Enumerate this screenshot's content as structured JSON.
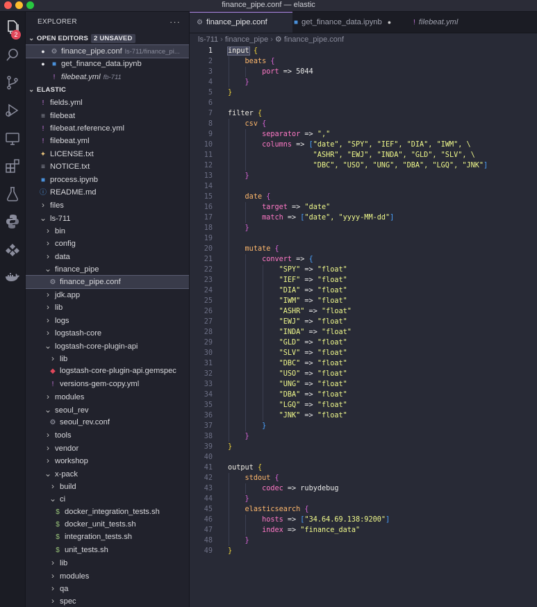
{
  "window": {
    "title": "finance_pipe.conf — elastic"
  },
  "activity": {
    "explorer_badge": "2"
  },
  "sidebar": {
    "header": "EXPLORER",
    "more": "···",
    "open_editors": {
      "label": "OPEN EDITORS",
      "badge": "2 UNSAVED",
      "items": [
        {
          "name": "finance_pipe.conf",
          "desc": "ls-711/finance_pi...",
          "icon": "gear",
          "dot": "●",
          "selected": true,
          "italic": false
        },
        {
          "name": "get_finance_data.ipynb",
          "desc": "",
          "icon": "notebook",
          "dot": "●",
          "selected": false,
          "italic": false
        },
        {
          "name": "filebeat.yml",
          "desc": "fb-711",
          "icon": "yaml",
          "dot": "",
          "selected": false,
          "italic": true
        }
      ]
    },
    "workspace": {
      "label": "ELASTIC",
      "items": [
        {
          "name": "fields.yml",
          "depth": 0,
          "icon": "yaml"
        },
        {
          "name": "filebeat",
          "depth": 0,
          "icon": "file"
        },
        {
          "name": "filebeat.reference.yml",
          "depth": 0,
          "icon": "yaml"
        },
        {
          "name": "filebeat.yml",
          "depth": 0,
          "icon": "yaml"
        },
        {
          "name": "LICENSE.txt",
          "depth": 0,
          "icon": "license"
        },
        {
          "name": "NOTICE.txt",
          "depth": 0,
          "icon": "file"
        },
        {
          "name": "process.ipynb",
          "depth": 0,
          "icon": "notebook"
        },
        {
          "name": "README.md",
          "depth": 0,
          "icon": "info"
        },
        {
          "name": "files",
          "depth": 0,
          "icon": "folder-closed"
        },
        {
          "name": "ls-711",
          "depth": 0,
          "icon": "folder-open"
        },
        {
          "name": "bin",
          "depth": 1,
          "icon": "folder-closed"
        },
        {
          "name": "config",
          "depth": 1,
          "icon": "folder-closed"
        },
        {
          "name": "data",
          "depth": 1,
          "icon": "folder-closed"
        },
        {
          "name": "finance_pipe",
          "depth": 1,
          "icon": "folder-open"
        },
        {
          "name": "finance_pipe.conf",
          "depth": 2,
          "icon": "gear",
          "selected": true
        },
        {
          "name": "jdk.app",
          "depth": 1,
          "icon": "folder-closed"
        },
        {
          "name": "lib",
          "depth": 1,
          "icon": "folder-closed"
        },
        {
          "name": "logs",
          "depth": 1,
          "icon": "folder-closed"
        },
        {
          "name": "logstash-core",
          "depth": 1,
          "icon": "folder-closed"
        },
        {
          "name": "logstash-core-plugin-api",
          "depth": 1,
          "icon": "folder-open"
        },
        {
          "name": "lib",
          "depth": 2,
          "icon": "folder-closed"
        },
        {
          "name": "logstash-core-plugin-api.gemspec",
          "depth": 2,
          "icon": "gem"
        },
        {
          "name": "versions-gem-copy.yml",
          "depth": 2,
          "icon": "yaml"
        },
        {
          "name": "modules",
          "depth": 1,
          "icon": "folder-closed"
        },
        {
          "name": "seoul_rev",
          "depth": 1,
          "icon": "folder-open"
        },
        {
          "name": "seoul_rev.conf",
          "depth": 2,
          "icon": "gear"
        },
        {
          "name": "tools",
          "depth": 1,
          "icon": "folder-closed"
        },
        {
          "name": "vendor",
          "depth": 1,
          "icon": "folder-closed"
        },
        {
          "name": "workshop",
          "depth": 1,
          "icon": "folder-closed"
        },
        {
          "name": "x-pack",
          "depth": 1,
          "icon": "folder-open"
        },
        {
          "name": "build",
          "depth": 2,
          "icon": "folder-closed"
        },
        {
          "name": "ci",
          "depth": 2,
          "icon": "folder-open"
        },
        {
          "name": "docker_integration_tests.sh",
          "depth": 3,
          "icon": "shell"
        },
        {
          "name": "docker_unit_tests.sh",
          "depth": 3,
          "icon": "shell"
        },
        {
          "name": "integration_tests.sh",
          "depth": 3,
          "icon": "shell"
        },
        {
          "name": "unit_tests.sh",
          "depth": 3,
          "icon": "shell"
        },
        {
          "name": "lib",
          "depth": 2,
          "icon": "folder-closed"
        },
        {
          "name": "modules",
          "depth": 2,
          "icon": "folder-closed"
        },
        {
          "name": "qa",
          "depth": 2,
          "icon": "folder-closed"
        },
        {
          "name": "spec",
          "depth": 2,
          "icon": "folder-closed"
        }
      ]
    }
  },
  "tabs": [
    {
      "label": "finance_pipe.conf",
      "icon": "gear",
      "active": true,
      "dirty": false,
      "italic": false
    },
    {
      "label": "get_finance_data.ipynb",
      "icon": "notebook",
      "active": false,
      "dirty": true,
      "italic": false
    },
    {
      "label": "filebeat.yml",
      "icon": "yaml",
      "active": false,
      "dirty": false,
      "italic": true
    }
  ],
  "breadcrumb": [
    "ls-711",
    "finance_pipe",
    "finance_pipe.conf"
  ],
  "editor": {
    "current_line": 1,
    "lines": [
      [
        [
          "input",
          "kw",
          "sel"
        ],
        [
          " "
        ],
        [
          "{",
          "b1"
        ]
      ],
      [
        [
          "    "
        ],
        [
          "beats",
          "plugin"
        ],
        [
          " "
        ],
        [
          "{",
          "b2"
        ]
      ],
      [
        [
          "        "
        ],
        [
          "port",
          "key"
        ],
        [
          " => ",
          "op"
        ],
        [
          "5044",
          "num"
        ]
      ],
      [
        [
          "    "
        ],
        [
          "}",
          "b2"
        ]
      ],
      [
        [
          "}",
          "b1"
        ]
      ],
      [],
      [
        [
          "filter",
          "kw"
        ],
        [
          " "
        ],
        [
          "{",
          "b1"
        ]
      ],
      [
        [
          "    "
        ],
        [
          "csv",
          "plugin"
        ],
        [
          " "
        ],
        [
          "{",
          "b2"
        ]
      ],
      [
        [
          "        "
        ],
        [
          "separator",
          "key"
        ],
        [
          " => ",
          "op"
        ],
        [
          "\",\"",
          "str"
        ]
      ],
      [
        [
          "        "
        ],
        [
          "columns",
          "key"
        ],
        [
          " => ",
          "op"
        ],
        [
          "[",
          "b3"
        ],
        [
          "\"date\", \"SPY\", \"IEF\", \"DIA\", \"IWM\", \\",
          "str"
        ]
      ],
      [
        [
          "                    "
        ],
        [
          "\"ASHR\", \"EWJ\", \"INDA\", \"GLD\", \"SLV\", \\",
          "str"
        ]
      ],
      [
        [
          "                    "
        ],
        [
          "\"DBC\", \"USO\", \"UNG\", \"DBA\", \"LGQ\", \"JNK\"",
          "str"
        ],
        [
          "]",
          "b3"
        ]
      ],
      [
        [
          "    "
        ],
        [
          "}",
          "b2"
        ]
      ],
      [],
      [
        [
          "    "
        ],
        [
          "date",
          "plugin"
        ],
        [
          " "
        ],
        [
          "{",
          "b2"
        ]
      ],
      [
        [
          "        "
        ],
        [
          "target",
          "key"
        ],
        [
          " => ",
          "op"
        ],
        [
          "\"date\"",
          "str"
        ]
      ],
      [
        [
          "        "
        ],
        [
          "match",
          "key"
        ],
        [
          " => ",
          "op"
        ],
        [
          "[",
          "b3"
        ],
        [
          "\"date\", \"yyyy-MM-dd\"",
          "str"
        ],
        [
          "]",
          "b3"
        ]
      ],
      [
        [
          "    "
        ],
        [
          "}",
          "b2"
        ]
      ],
      [],
      [
        [
          "    "
        ],
        [
          "mutate",
          "plugin"
        ],
        [
          " "
        ],
        [
          "{",
          "b2"
        ]
      ],
      [
        [
          "        "
        ],
        [
          "convert",
          "key"
        ],
        [
          " => ",
          "op"
        ],
        [
          "{",
          "b3"
        ]
      ],
      [
        [
          "            "
        ],
        [
          "\"SPY\"",
          "str"
        ],
        [
          " => ",
          "op"
        ],
        [
          "\"float\"",
          "str"
        ]
      ],
      [
        [
          "            "
        ],
        [
          "\"IEF\"",
          "str"
        ],
        [
          " => ",
          "op"
        ],
        [
          "\"float\"",
          "str"
        ]
      ],
      [
        [
          "            "
        ],
        [
          "\"DIA\"",
          "str"
        ],
        [
          " => ",
          "op"
        ],
        [
          "\"float\"",
          "str"
        ]
      ],
      [
        [
          "            "
        ],
        [
          "\"IWM\"",
          "str"
        ],
        [
          " => ",
          "op"
        ],
        [
          "\"float\"",
          "str"
        ]
      ],
      [
        [
          "            "
        ],
        [
          "\"ASHR\"",
          "str"
        ],
        [
          " => ",
          "op"
        ],
        [
          "\"float\"",
          "str"
        ]
      ],
      [
        [
          "            "
        ],
        [
          "\"EWJ\"",
          "str"
        ],
        [
          " => ",
          "op"
        ],
        [
          "\"float\"",
          "str"
        ]
      ],
      [
        [
          "            "
        ],
        [
          "\"INDA\"",
          "str"
        ],
        [
          " => ",
          "op"
        ],
        [
          "\"float\"",
          "str"
        ]
      ],
      [
        [
          "            "
        ],
        [
          "\"GLD\"",
          "str"
        ],
        [
          " => ",
          "op"
        ],
        [
          "\"float\"",
          "str"
        ]
      ],
      [
        [
          "            "
        ],
        [
          "\"SLV\"",
          "str"
        ],
        [
          " => ",
          "op"
        ],
        [
          "\"float\"",
          "str"
        ]
      ],
      [
        [
          "            "
        ],
        [
          "\"DBC\"",
          "str"
        ],
        [
          " => ",
          "op"
        ],
        [
          "\"float\"",
          "str"
        ]
      ],
      [
        [
          "            "
        ],
        [
          "\"USO\"",
          "str"
        ],
        [
          " => ",
          "op"
        ],
        [
          "\"float\"",
          "str"
        ]
      ],
      [
        [
          "            "
        ],
        [
          "\"UNG\"",
          "str"
        ],
        [
          " => ",
          "op"
        ],
        [
          "\"float\"",
          "str"
        ]
      ],
      [
        [
          "            "
        ],
        [
          "\"DBA\"",
          "str"
        ],
        [
          " => ",
          "op"
        ],
        [
          "\"float\"",
          "str"
        ]
      ],
      [
        [
          "            "
        ],
        [
          "\"LGQ\"",
          "str"
        ],
        [
          " => ",
          "op"
        ],
        [
          "\"float\"",
          "str"
        ]
      ],
      [
        [
          "            "
        ],
        [
          "\"JNK\"",
          "str"
        ],
        [
          " => ",
          "op"
        ],
        [
          "\"float\"",
          "str"
        ]
      ],
      [
        [
          "        "
        ],
        [
          "}",
          "b3"
        ]
      ],
      [
        [
          "    "
        ],
        [
          "}",
          "b2"
        ]
      ],
      [
        [
          "}",
          "b1"
        ]
      ],
      [],
      [
        [
          "output",
          "kw"
        ],
        [
          " "
        ],
        [
          "{",
          "b1"
        ]
      ],
      [
        [
          "    "
        ],
        [
          "stdout",
          "plugin"
        ],
        [
          " "
        ],
        [
          "{",
          "b2"
        ]
      ],
      [
        [
          "        "
        ],
        [
          "codec",
          "key"
        ],
        [
          " => ",
          "op"
        ],
        [
          "rubydebug",
          "plain"
        ]
      ],
      [
        [
          "    "
        ],
        [
          "}",
          "b2"
        ]
      ],
      [
        [
          "    "
        ],
        [
          "elasticsearch",
          "plugin"
        ],
        [
          " "
        ],
        [
          "{",
          "b2"
        ]
      ],
      [
        [
          "        "
        ],
        [
          "hosts",
          "key"
        ],
        [
          " => ",
          "op"
        ],
        [
          "[",
          "b3"
        ],
        [
          "\"34.64.69.138:9200\"",
          "str"
        ],
        [
          "]",
          "b3"
        ]
      ],
      [
        [
          "        "
        ],
        [
          "index",
          "key"
        ],
        [
          " => ",
          "op"
        ],
        [
          "\"finance_data\"",
          "str"
        ]
      ],
      [
        [
          "    "
        ],
        [
          "}",
          "b2"
        ]
      ],
      [
        [
          "}",
          "b1"
        ]
      ]
    ]
  }
}
